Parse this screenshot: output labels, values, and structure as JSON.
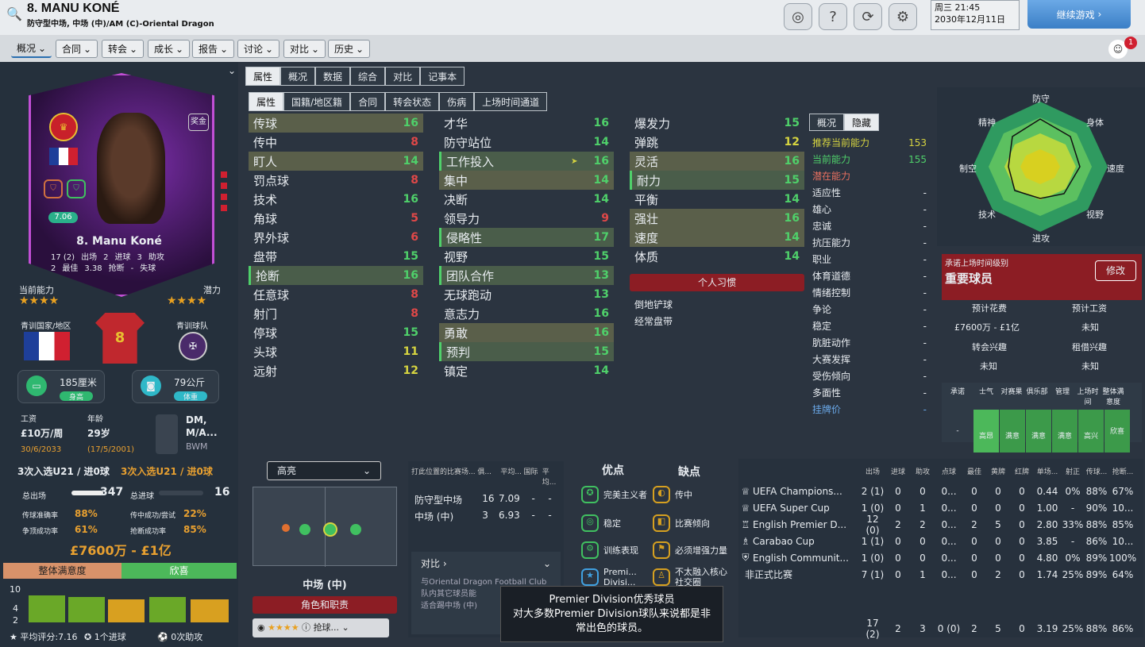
{
  "header": {
    "title": "8. MANU KONÉ",
    "subtitle": "防守型中场, 中场 (中)/AM (C)-Oriental Dragon",
    "day": "周三 21:45",
    "date": "2030年12月11日",
    "continue": "继续游戏",
    "notif": "1"
  },
  "nav": [
    "概况",
    "合同",
    "转会",
    "成长",
    "报告",
    "讨论",
    "对比",
    "历史"
  ],
  "card": {
    "name": "8. Manu Koné",
    "rating": "7.06",
    "badge": "奖金",
    "apps": "17 (2)",
    "apps_l": "出场",
    "goals": "2",
    "goals_l": "进球",
    "assists": "3",
    "assists_l": "助攻",
    "best": "2",
    "best_l": "最佳",
    "avg": "3.38",
    "avg_l": "抢断",
    "minus": "-",
    "minus_l": "失球"
  },
  "ability": {
    "cur_l": "当前能力",
    "pot_l": "潜力",
    "cur_stars": "★★★★",
    "pot_stars": "★★★★",
    "nation_l": "青训国家/地区",
    "club_l": "青训球队"
  },
  "phys": {
    "height": "185厘米",
    "height_l": "身高",
    "weight": "79公斤",
    "weight_l": "体重"
  },
  "info": {
    "wage_l": "工资",
    "wage": "£10万/周",
    "wage_exp": "30/6/2033",
    "age_l": "年龄",
    "age": "29岁",
    "dob": "(17/5/2001)",
    "pos": "DM, M/A...",
    "pos2": "BWM",
    "u21a": "3次入选U21 / 进0球",
    "u21b": "3次入选U21 / 进0球"
  },
  "totals": {
    "shots_l": "总出场",
    "shots": "347",
    "goals_l": "总进球",
    "goals": "16",
    "pass_l": "传球准确率",
    "pass": "88%",
    "cross_l": "传中成功/尝试",
    "cross": "22%",
    "head_l": "争顶成功率",
    "head": "61%",
    "tackle_l": "抢断成功率",
    "tackle": "85%",
    "value": "£7600万 - £1亿"
  },
  "satisfaction": {
    "label": "整体满意度",
    "val": "欣喜",
    "avg": "平均评分:7.16",
    "goals": "1个进球",
    "assists": "0次助攻",
    "ymax": "10",
    "ymid": "4",
    "ymin": "2"
  },
  "tabs1": [
    "属性",
    "概况",
    "数据",
    "综合",
    "对比",
    "记事本"
  ],
  "tabs2": [
    "属性",
    "国籍/地区籍",
    "合同",
    "转会状态",
    "伤病",
    "上场时间通道"
  ],
  "col1": [
    [
      "传球",
      "16"
    ],
    [
      "传中",
      "8"
    ],
    [
      "盯人",
      "14"
    ],
    [
      "罚点球",
      "8"
    ],
    [
      "技术",
      "16"
    ],
    [
      "角球",
      "5"
    ],
    [
      "界外球",
      "6"
    ],
    [
      "盘带",
      "15"
    ],
    [
      "抢断",
      "16"
    ],
    [
      "任意球",
      "8"
    ],
    [
      "射门",
      "8"
    ],
    [
      "停球",
      "15"
    ],
    [
      "头球",
      "11"
    ],
    [
      "远射",
      "12"
    ]
  ],
  "col2": [
    [
      "才华",
      "16"
    ],
    [
      "防守站位",
      "14"
    ],
    [
      "工作投入",
      "16"
    ],
    [
      "集中",
      "14"
    ],
    [
      "决断",
      "14"
    ],
    [
      "领导力",
      "9"
    ],
    [
      "侵略性",
      "17"
    ],
    [
      "视野",
      "15"
    ],
    [
      "团队合作",
      "13"
    ],
    [
      "无球跑动",
      "13"
    ],
    [
      "意志力",
      "16"
    ],
    [
      "勇敢",
      "16"
    ],
    [
      "预判",
      "15"
    ],
    [
      "镇定",
      "14"
    ]
  ],
  "col3": [
    [
      "爆发力",
      "15"
    ],
    [
      "弹跳",
      "12"
    ],
    [
      "灵活",
      "16"
    ],
    [
      "耐力",
      "15"
    ],
    [
      "平衡",
      "14"
    ],
    [
      "强壮",
      "16"
    ],
    [
      "速度",
      "14"
    ],
    [
      "体质",
      "14"
    ]
  ],
  "traits": {
    "title": "个人习惯",
    "t1": "倒地铲球",
    "t2": "经常盘带"
  },
  "hidden": {
    "tab1": "概况",
    "tab2": "隐藏",
    "rows": [
      [
        "推荐当前能力",
        "153"
      ],
      [
        "当前能力",
        "155"
      ],
      [
        "潜在能力",
        ""
      ],
      [
        "适应性",
        "-"
      ],
      [
        "雄心",
        "-"
      ],
      [
        "忠诚",
        "-"
      ],
      [
        "抗压能力",
        "-"
      ],
      [
        "职业",
        "-"
      ],
      [
        "体育道德",
        "-"
      ],
      [
        "情绪控制",
        "-"
      ],
      [
        "争论",
        "-"
      ],
      [
        "稳定",
        "-"
      ],
      [
        "肮脏动作",
        "-"
      ],
      [
        "大赛发挥",
        "-"
      ],
      [
        "受伤倾向",
        "-"
      ],
      [
        "多面性",
        "-"
      ],
      [
        "挂牌价",
        "-"
      ]
    ]
  },
  "radar": [
    "防守",
    "身体",
    "速度",
    "视野",
    "进攻",
    "技术",
    "制空",
    "精神"
  ],
  "promise": {
    "label": "承诺上场时间级别",
    "value": "重要球员",
    "edit": "修改",
    "fee_l": "预计花费",
    "wage_l": "预计工资",
    "fee": "£7600万 - £1亿",
    "wage": "未知",
    "transfer_l": "转会兴趣",
    "loan_l": "租借兴趣",
    "transfer": "未知",
    "loan": "未知"
  },
  "happy": {
    "cols": [
      "承诺",
      "士气",
      "对赛果",
      "俱乐部",
      "管理",
      "上场时间",
      "整体满意度"
    ],
    "vals": [
      "-",
      "高昂",
      "满意",
      "满意",
      "满意",
      "高兴",
      "欣喜"
    ]
  },
  "role": {
    "select": "高亮",
    "pos": "中场 (中)",
    "btn": "角色和职责",
    "sub": "抢球..."
  },
  "posperf": {
    "headers": [
      "打此位置的比赛场...",
      "俱...",
      "平均...",
      "国际",
      "平均..."
    ],
    "rows": [
      [
        "防守型中场",
        "16",
        "7.09",
        "-",
        "-"
      ],
      [
        "中场 (中)",
        "3",
        "6.93",
        "-",
        "-"
      ]
    ],
    "cmp": "对比",
    "cmp_text": "与Oriental Dragon Football Club队内其它球员能",
    "cmp_text2": "适合踢中场 (中)"
  },
  "strengths": {
    "s_l": "优点",
    "w_l": "缺点",
    "s": [
      "完美主义者",
      "稳定",
      "训练表现",
      "Premi... Divisi..."
    ],
    "w": [
      "传中",
      "比赛倾向",
      "必须增强力量",
      "不太融入核心社交圈"
    ]
  },
  "comps": {
    "headers": [
      "出场",
      "进球",
      "助攻",
      "点球",
      "最佳",
      "黄牌",
      "红牌",
      "单场...",
      "射正",
      "传球...",
      "抢断..."
    ],
    "rows": [
      [
        "UEFA Champions...",
        "2 (1)",
        "0",
        "0",
        "0...",
        "0",
        "0",
        "0",
        "0.44",
        "0%",
        "88%",
        "67%"
      ],
      [
        "UEFA Super Cup",
        "1 (0)",
        "0",
        "1",
        "0...",
        "0",
        "0",
        "0",
        "1.00",
        "-",
        "90%",
        "10..."
      ],
      [
        "English Premier D...",
        "12 (0)",
        "2",
        "2",
        "0...",
        "2",
        "5",
        "0",
        "2.80",
        "33%",
        "88%",
        "85%"
      ],
      [
        "Carabao Cup",
        "1 (1)",
        "0",
        "0",
        "0...",
        "0",
        "0",
        "0",
        "3.85",
        "-",
        "86%",
        "10..."
      ],
      [
        "English Communit...",
        "1 (0)",
        "0",
        "0",
        "0...",
        "0",
        "0",
        "0",
        "4.80",
        "0%",
        "89%",
        "100%"
      ],
      [
        "非正式比赛",
        "7 (1)",
        "0",
        "1",
        "0...",
        "0",
        "2",
        "0",
        "1.74",
        "25%",
        "89%",
        "64%"
      ]
    ],
    "total": [
      "17 (2)",
      "2",
      "3",
      "0 (0)",
      "2",
      "5",
      "0",
      "3.19",
      "25%",
      "88%",
      "86%"
    ]
  },
  "tooltip": {
    "l1": "Premier Division优秀球员",
    "l2": "对大多数Premier Division球队来说都是非",
    "l3": "常出色的球员。"
  }
}
